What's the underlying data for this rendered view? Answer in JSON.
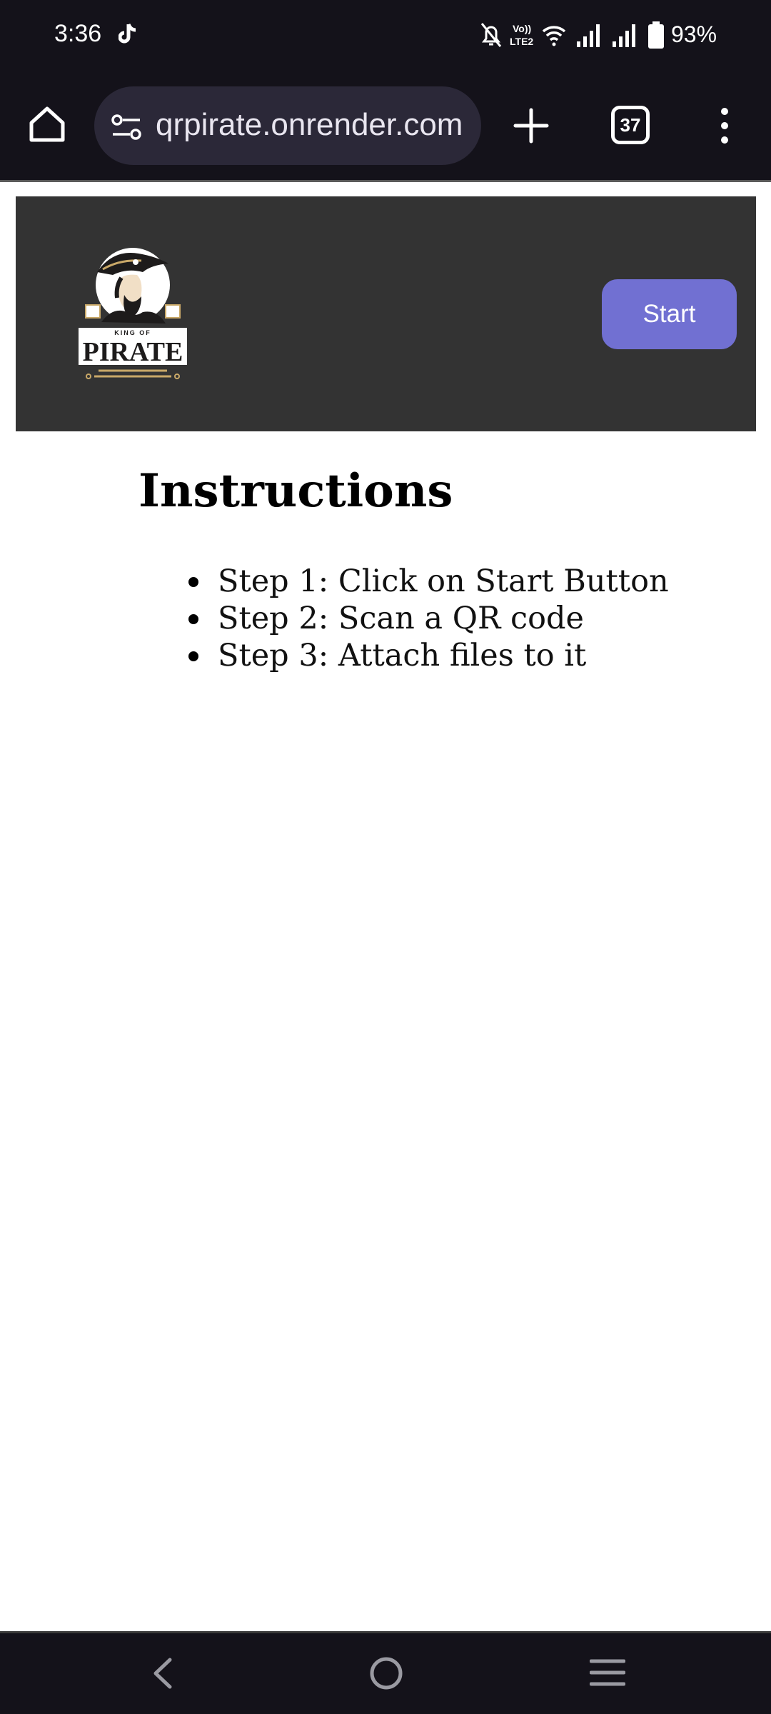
{
  "status_bar": {
    "time": "3:36",
    "battery_percent": "93%",
    "network_label": "VoLTE2"
  },
  "browser": {
    "url": "qrpirate.onrender.com",
    "tab_count": "37"
  },
  "header": {
    "logo_text": "KING OF PIRATE",
    "start_label": "Start",
    "start_color": "#7170d2",
    "background": "#333333"
  },
  "main": {
    "title": "Instructions",
    "steps": [
      "Step 1: Click on Start Button",
      "Step 2: Scan a QR code",
      "Step 3: Attach files to it"
    ]
  },
  "icons": {
    "home": "home-icon",
    "site_settings": "tune-icon",
    "new_tab": "plus-icon",
    "menu": "more-vertical-icon",
    "nav_back": "chevron-left-icon",
    "nav_home": "circle-home-icon",
    "nav_recents": "recents-icon"
  }
}
